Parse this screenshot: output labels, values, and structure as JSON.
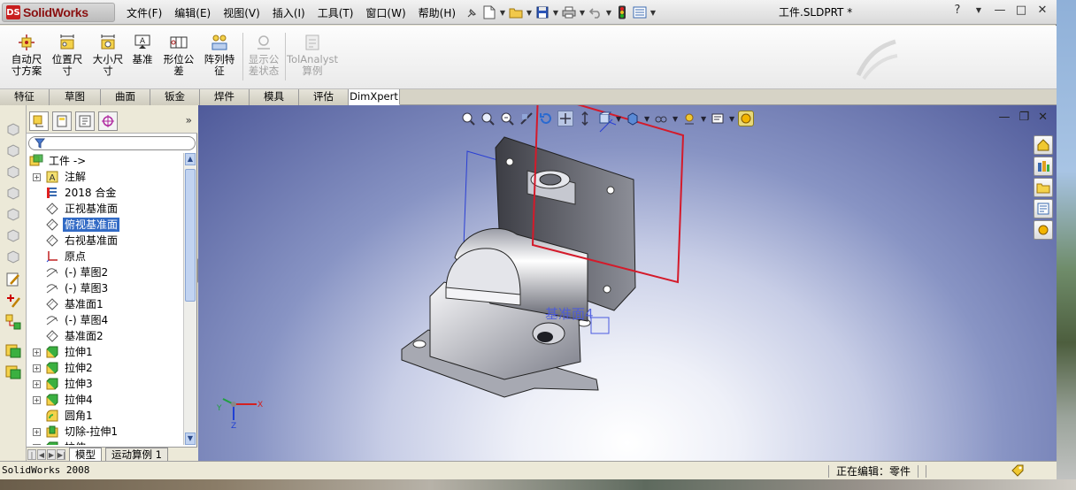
{
  "app": {
    "name": "SolidWorks",
    "window_title": "工件.SLDPRT *",
    "logo_mark": "DS"
  },
  "menu": {
    "items": [
      "文件(F)",
      "编辑(E)",
      "视图(V)",
      "插入(I)",
      "工具(T)",
      "窗口(W)",
      "帮助(H)"
    ]
  },
  "title_controls": {
    "help": "?",
    "minimize": "—",
    "maximize": "□",
    "close": "✕"
  },
  "ribbon": {
    "commands": [
      {
        "label": "自动尺寸方案",
        "icon": "auto-dimension-icon",
        "disabled": false
      },
      {
        "label": "位置尺寸",
        "icon": "location-dimension-icon",
        "disabled": false
      },
      {
        "label": "大小尺寸",
        "icon": "size-dimension-icon",
        "disabled": false
      },
      {
        "label": "基准",
        "icon": "datum-icon",
        "disabled": false
      },
      {
        "label": "形位公差",
        "icon": "geometric-tolerance-icon",
        "disabled": false
      },
      {
        "label": "阵列特征",
        "icon": "pattern-feature-icon",
        "disabled": false
      },
      {
        "label": "显示公差状态",
        "icon": "show-tolerance-status-icon",
        "disabled": true
      },
      {
        "label": "TolAnalyst算例",
        "icon": "tolanalyst-icon",
        "disabled": true
      }
    ]
  },
  "tabs": [
    "特征",
    "草图",
    "曲面",
    "钣金",
    "焊件",
    "模具",
    "评估",
    "DimXpert"
  ],
  "active_tab": "DimXpert",
  "feature_tree": {
    "root": "工件 ->",
    "items": [
      {
        "label": "注解",
        "icon": "annotations-icon",
        "expandable": true,
        "selected": false
      },
      {
        "label": "2018 合金",
        "icon": "material-icon",
        "expandable": false,
        "selected": false
      },
      {
        "label": "正视基准面",
        "icon": "plane-icon",
        "expandable": false,
        "selected": false
      },
      {
        "label": "俯视基准面",
        "icon": "plane-icon",
        "expandable": false,
        "selected": true
      },
      {
        "label": "右视基准面",
        "icon": "plane-icon",
        "expandable": false,
        "selected": false
      },
      {
        "label": "原点",
        "icon": "origin-icon",
        "expandable": false,
        "selected": false
      },
      {
        "label": "(-) 草图2",
        "icon": "sketch-icon",
        "expandable": false,
        "selected": false
      },
      {
        "label": "(-) 草图3",
        "icon": "sketch-icon",
        "expandable": false,
        "selected": false
      },
      {
        "label": "基准面1",
        "icon": "plane-icon",
        "expandable": false,
        "selected": false
      },
      {
        "label": "(-) 草图4",
        "icon": "sketch-icon",
        "expandable": false,
        "selected": false
      },
      {
        "label": "基准面2",
        "icon": "plane-icon",
        "expandable": false,
        "selected": false
      },
      {
        "label": "拉伸1",
        "icon": "extrude-icon",
        "expandable": true,
        "selected": false
      },
      {
        "label": "拉伸2",
        "icon": "extrude-icon",
        "expandable": true,
        "selected": false
      },
      {
        "label": "拉伸3",
        "icon": "extrude-icon",
        "expandable": true,
        "selected": false
      },
      {
        "label": "拉伸4",
        "icon": "extrude-icon",
        "expandable": true,
        "selected": false
      },
      {
        "label": "圆角1",
        "icon": "fillet-icon",
        "expandable": false,
        "selected": false
      },
      {
        "label": "切除-拉伸1",
        "icon": "cut-extrude-icon",
        "expandable": true,
        "selected": false
      },
      {
        "label": "拉伸",
        "icon": "extrude-icon",
        "expandable": true,
        "selected": false
      }
    ]
  },
  "bottom_tabs": [
    "模型",
    "运动算例 1"
  ],
  "viewport": {
    "plane_label": "基准面4",
    "triad": {
      "x": "X",
      "y": "Y",
      "z": "Z"
    }
  },
  "status": {
    "left": "SolidWorks 2008",
    "mode": "正在编辑：零件"
  },
  "colors": {
    "selection": "#316ac5",
    "plane_red": "#d41a2a",
    "plane_blue": "#2a3fd4"
  }
}
